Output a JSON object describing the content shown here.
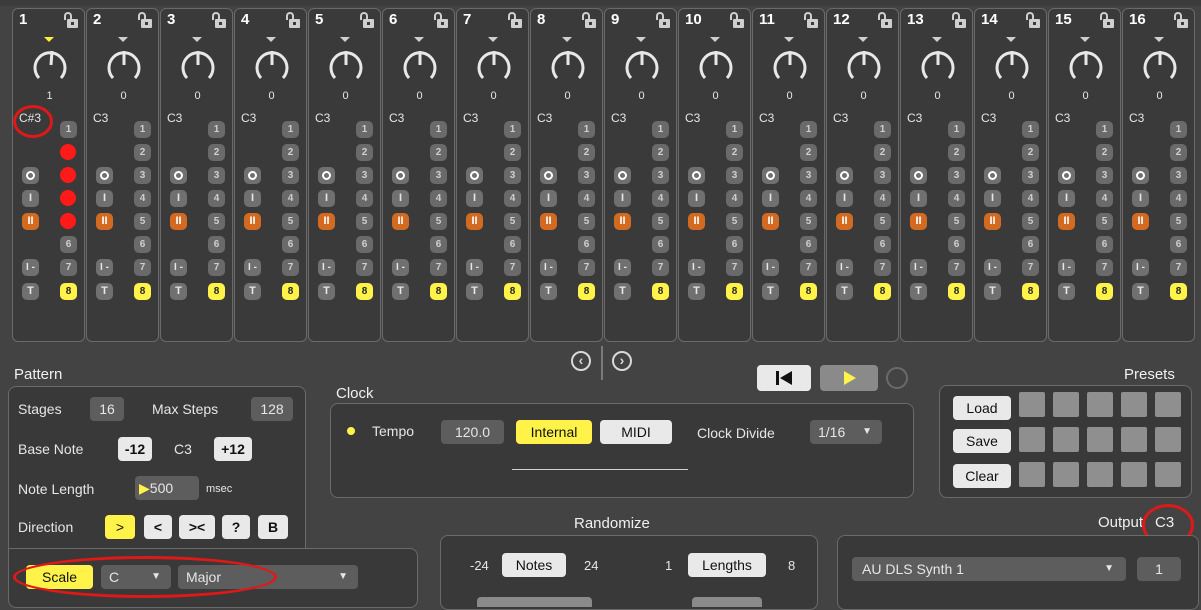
{
  "stages": [
    {
      "num": "1",
      "knob_value": "1",
      "note": "C#3",
      "active": true
    },
    {
      "num": "2",
      "knob_value": "0",
      "note": "C3",
      "active": false
    },
    {
      "num": "3",
      "knob_value": "0",
      "note": "C3",
      "active": false
    },
    {
      "num": "4",
      "knob_value": "0",
      "note": "C3",
      "active": false
    },
    {
      "num": "5",
      "knob_value": "0",
      "note": "C3",
      "active": false
    },
    {
      "num": "6",
      "knob_value": "0",
      "note": "C3",
      "active": false
    },
    {
      "num": "7",
      "knob_value": "0",
      "note": "C3",
      "active": false
    },
    {
      "num": "8",
      "knob_value": "0",
      "note": "C3",
      "active": false
    },
    {
      "num": "9",
      "knob_value": "0",
      "note": "C3",
      "active": false
    },
    {
      "num": "10",
      "knob_value": "0",
      "note": "C3",
      "active": false
    },
    {
      "num": "11",
      "knob_value": "0",
      "note": "C3",
      "active": false
    },
    {
      "num": "12",
      "knob_value": "0",
      "note": "C3",
      "active": false
    },
    {
      "num": "13",
      "knob_value": "0",
      "note": "C3",
      "active": false
    },
    {
      "num": "14",
      "knob_value": "0",
      "note": "C3",
      "active": false
    },
    {
      "num": "15",
      "knob_value": "0",
      "note": "C3",
      "active": false
    },
    {
      "num": "16",
      "knob_value": "0",
      "note": "C3",
      "active": false
    }
  ],
  "step_numbers": [
    "1",
    "2",
    "3",
    "4",
    "5",
    "6",
    "7",
    "8"
  ],
  "selected_step": "8",
  "stage_buttons": {
    "hold": "I",
    "reset": "I -",
    "tie": "T",
    "mute_icon": "II"
  },
  "first_stage_active_steps": [
    "2",
    "3",
    "4",
    "5"
  ],
  "pattern": {
    "label": "Pattern",
    "stages_label": "Stages",
    "stages_value": "16",
    "max_steps_label": "Max Steps",
    "max_steps_value": "128",
    "base_note_label": "Base Note",
    "base_note_down": "-12",
    "base_note_value": "C3",
    "base_note_up": "+12",
    "note_length_label": "Note Length",
    "note_length_value": "500",
    "note_length_unit": "msec",
    "direction_label": "Direction",
    "directions": [
      ">",
      "<",
      "><",
      "?",
      "B"
    ],
    "scale_label": "Scale",
    "scale_key": "C",
    "scale_type": "Major"
  },
  "clock": {
    "label": "Clock",
    "tempo_label": "Tempo",
    "tempo_value": "120.0",
    "internal_label": "Internal",
    "midi_label": "MIDI",
    "divide_label": "Clock Divide",
    "divide_value": "1/16"
  },
  "transport": {
    "rewind_icon": "rewind-icon",
    "play_icon": "play-icon"
  },
  "presets": {
    "label": "Presets",
    "load": "Load",
    "save": "Save",
    "clear": "Clear"
  },
  "randomize": {
    "label": "Randomize",
    "notes_min": "-24",
    "notes_label": "Notes",
    "notes_max": "24",
    "lengths_min": "1",
    "lengths_label": "Lengths",
    "lengths_max": "8"
  },
  "output": {
    "label": "Output",
    "note": "C3",
    "device": "AU DLS Synth 1",
    "channel": "1"
  },
  "colors": {
    "accent_yellow": "#fff34a",
    "mute_orange": "#d36a21",
    "active_red": "#ff1a1a",
    "annotation_red": "#e01818"
  }
}
